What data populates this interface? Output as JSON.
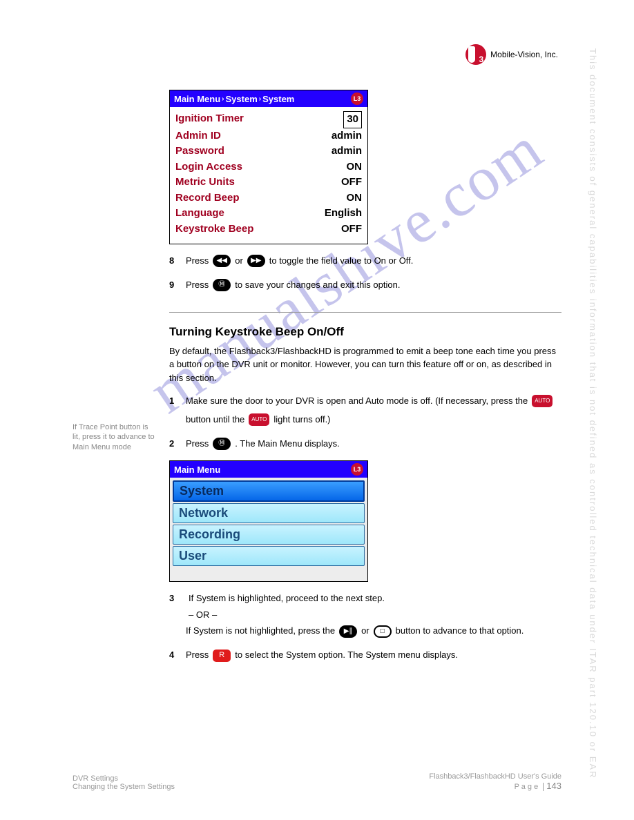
{
  "brand": {
    "company": "Mobile-Vision, Inc.",
    "logo_small": "L3"
  },
  "side_notice": "This document consists of general capabilities information that is not defined as controlled technical data under  ITAR part 120.10 or EAR",
  "watermark": "manualshive.com",
  "panel1": {
    "breadcrumb": [
      "Main Menu",
      "System",
      "System"
    ],
    "rows": [
      {
        "label": "Ignition Timer",
        "value": "30",
        "boxed": true
      },
      {
        "label": "Admin ID",
        "value": "admin"
      },
      {
        "label": "Password",
        "value": "admin"
      },
      {
        "label": "Login Access",
        "value": "ON"
      },
      {
        "label": "Metric Units",
        "value": "OFF"
      },
      {
        "label": "Record Beep",
        "value": "ON"
      },
      {
        "label": "Language",
        "value": "English"
      },
      {
        "label": "Keystroke Beep",
        "value": "OFF"
      }
    ]
  },
  "step8": {
    "num": "8",
    "pre": "Press",
    "or": "or",
    "post": "to toggle the field value to On or Off."
  },
  "step9": {
    "num": "9",
    "pre": "Press",
    "post": "to save your changes and exit this option."
  },
  "section2": {
    "title": "Turning Keystroke Beep On/Off",
    "body": "By default, the Flashback3/FlashbackHD is programmed to emit a beep tone each time you press a button on the DVR unit or monitor. However, you can turn this feature off or on, as described in this section.",
    "margin_note": "If Trace Point button is lit, press it to advance to Main Menu mode",
    "step1": {
      "num": "1",
      "text1": "Make sure the door to your DVR is open and Auto mode is off. (If necessary, press the",
      "auto_label": "AUTO",
      "text2": "button until the",
      "text3": "light turns off.)"
    },
    "step2": {
      "num": "2",
      "pre": "Press",
      "post": ". The Main Menu displays."
    }
  },
  "panel2": {
    "header": "Main Menu",
    "items": [
      "System",
      "Network",
      "Recording",
      "User"
    ]
  },
  "section3": {
    "step3": {
      "num": "3",
      "text1": "If System is highlighted, proceed to the next step.",
      "text2_pre": "If System is not highlighted, press the",
      "or": "or",
      "text2_post": "button to advance to that option."
    },
    "step4": {
      "num": "4",
      "pre": "Press",
      "post": "to select the System option. The System menu displays."
    }
  },
  "footer": {
    "left_line1": "DVR Settings",
    "left_line2": "Changing the System Settings",
    "right_line1": "Flashback3/FlashbackHD User's Guide",
    "right_line2_label": "P a g e",
    "right_line2_page": "143"
  }
}
